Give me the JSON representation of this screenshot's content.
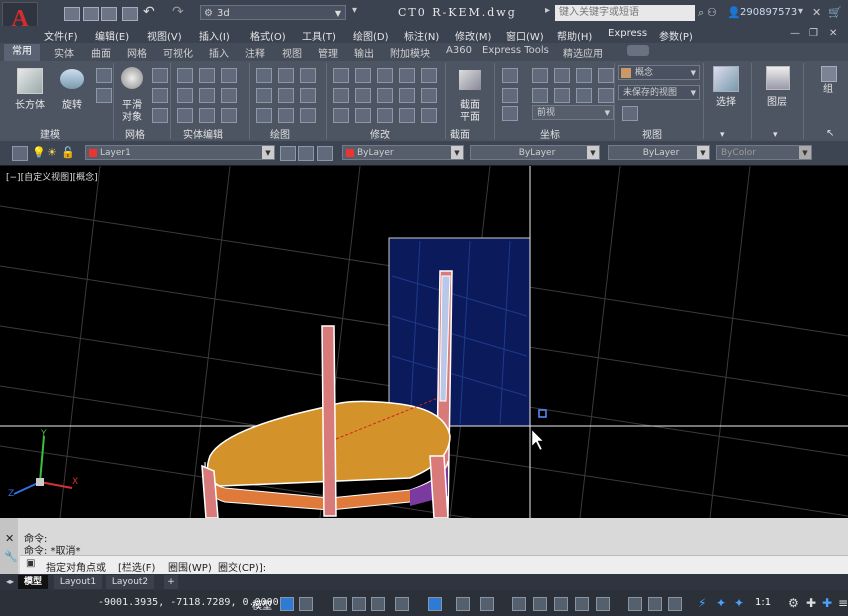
{
  "titlebar": {
    "app_letter": "A",
    "workspace": "3d",
    "file_title": "CT0 R-KEM.dwg",
    "search_placeholder": "键入关键字或短语",
    "user": "290897573"
  },
  "menubar": {
    "items": [
      "文件(F)",
      "编辑(E)",
      "视图(V)",
      "插入(I)",
      "格式(O)",
      "工具(T)",
      "绘图(D)",
      "标注(N)",
      "修改(M)",
      "窗口(W)",
      "帮助(H)",
      "Express",
      "参数(P)"
    ]
  },
  "ribbon_tabs": {
    "items": [
      "常用",
      "实体",
      "曲面",
      "网格",
      "可视化",
      "插入",
      "注释",
      "视图",
      "管理",
      "输出",
      "附加模块",
      "A360",
      "Express Tools",
      "精选应用"
    ]
  },
  "ribbon": {
    "box_label": "长方体",
    "revolve_label": "旋转",
    "smooth_label1": "平滑",
    "smooth_label2": "对象",
    "section_label1": "截面",
    "section_label2": "平面",
    "visual_style": "概念",
    "saved_view": "未保存的视图",
    "view_name": "前视",
    "select_label": "选择",
    "layers_label": "图层",
    "group_label": "组",
    "panels": [
      "建模",
      "网格",
      "实体编辑",
      "绘图",
      "修改",
      "截面",
      "坐标",
      "视图"
    ]
  },
  "layerbar": {
    "layer": "Layer1",
    "color": "ByLayer",
    "linetype": "ByLayer",
    "lineweight": "ByLayer",
    "plotstyle": "ByColor"
  },
  "drawing": {
    "viewport_label": "[−][自定义视图][概念]",
    "axes": {
      "x": "X",
      "y": "Y",
      "z": "Z"
    }
  },
  "command": {
    "line1": "命令:",
    "line2": "命令: *取消*",
    "prompt": "指定对角点或",
    "opt1": "[栏选(F)",
    "opt2": "圈围(WP)",
    "opt3": "圈交(CP)]:"
  },
  "layouts": {
    "model": "模型",
    "layout1": "Layout1",
    "layout2": "Layout2"
  },
  "statusbar": {
    "coords": "-9001.3935, -7118.7289, 0.0000",
    "mode": "模型",
    "scale": "1:1"
  },
  "colors": {
    "seat": "#d4932a",
    "legs": "#d87a7a",
    "selection_fill": "#0b1a5a",
    "highlight": "#ffffff"
  }
}
